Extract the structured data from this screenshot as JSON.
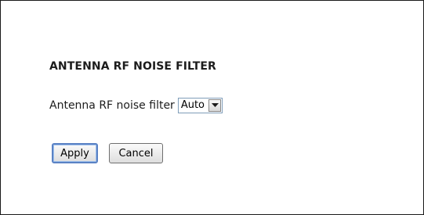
{
  "section": {
    "title": "ANTENNA RF NOISE FILTER"
  },
  "setting": {
    "label": "Antenna RF noise filter",
    "selected_value": "Auto"
  },
  "buttons": {
    "apply_label": "Apply",
    "cancel_label": "Cancel"
  },
  "icons": {
    "dropdown_arrow": "chevron-down-icon"
  }
}
